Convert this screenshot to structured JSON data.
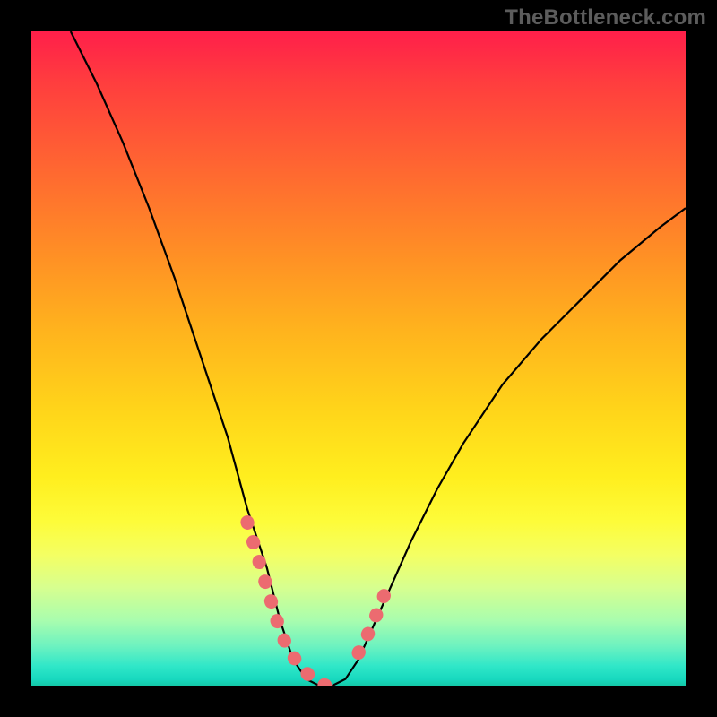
{
  "watermark": "TheBottleneck.com",
  "chart_data": {
    "type": "line",
    "title": "",
    "xlabel": "",
    "ylabel": "",
    "xlim": [
      0,
      1
    ],
    "ylim": [
      0,
      1
    ],
    "series": [
      {
        "name": "bottleneck-curve",
        "x": [
          0.06,
          0.1,
          0.14,
          0.18,
          0.22,
          0.26,
          0.3,
          0.33,
          0.36,
          0.38,
          0.4,
          0.42,
          0.44,
          0.46,
          0.48,
          0.5,
          0.54,
          0.58,
          0.62,
          0.66,
          0.72,
          0.78,
          0.84,
          0.9,
          0.96,
          1.0
        ],
        "y": [
          1.0,
          0.92,
          0.83,
          0.73,
          0.62,
          0.5,
          0.38,
          0.27,
          0.18,
          0.1,
          0.04,
          0.01,
          0.0,
          0.0,
          0.01,
          0.04,
          0.13,
          0.22,
          0.3,
          0.37,
          0.46,
          0.53,
          0.59,
          0.65,
          0.7,
          0.73
        ]
      },
      {
        "name": "highlight-left",
        "x": [
          0.33,
          0.345,
          0.36,
          0.375,
          0.39,
          0.41,
          0.43,
          0.45,
          0.47
        ],
        "y": [
          0.25,
          0.2,
          0.15,
          0.1,
          0.06,
          0.03,
          0.01,
          0.0,
          0.01
        ]
      },
      {
        "name": "highlight-right",
        "x": [
          0.5,
          0.52,
          0.54
        ],
        "y": [
          0.05,
          0.09,
          0.14
        ]
      }
    ],
    "colors": {
      "curve": "#000000",
      "highlight": "#ec6b70",
      "gradient_top": "#ff1f4a",
      "gradient_bottom": "#14c9a8"
    }
  }
}
